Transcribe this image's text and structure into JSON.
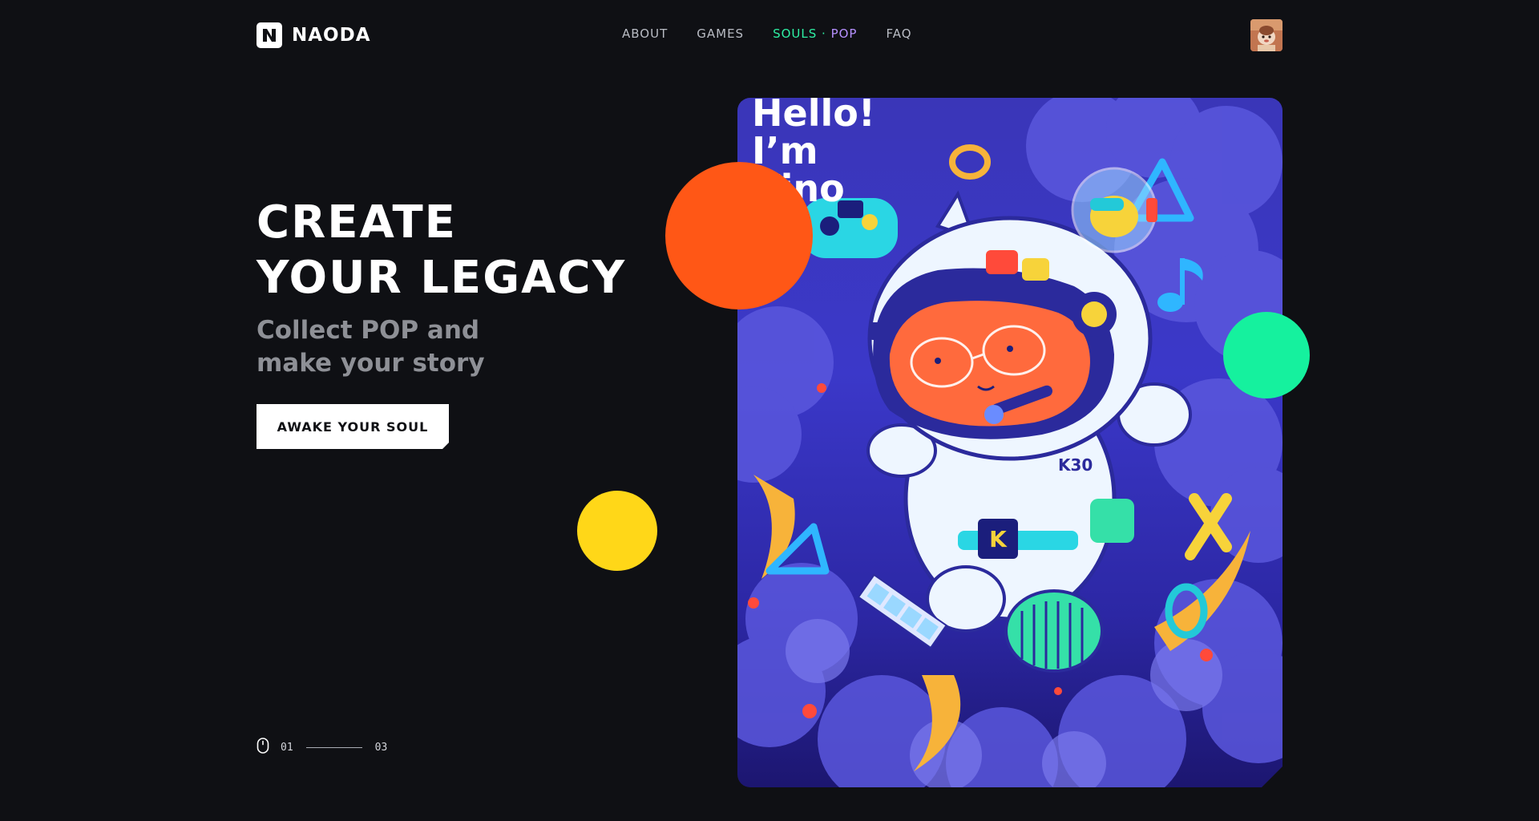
{
  "header": {
    "logo_text": "NAODA",
    "nav": {
      "about": "ABOUT",
      "games": "GAMES",
      "souls_pop_a": "SOULS",
      "souls_pop_sep": " · ",
      "souls_pop_b": "POP",
      "faq": "FAQ"
    }
  },
  "hero": {
    "title_line1": "CREATE",
    "title_line2": "YOUR LEGACY",
    "subtitle_line1": "Collect POP and",
    "subtitle_line2": "make your story",
    "cta_label": "AWAKE YOUR SOUL"
  },
  "indicator": {
    "current": "01",
    "total": "03",
    "progress_fraction": 0.33
  },
  "artwork": {
    "greeting_line1": "Hello!",
    "greeting_line2": "I’m",
    "greeting_line3": "Kino",
    "badge_text": "K30",
    "belt_letter": "K"
  },
  "colors": {
    "background": "#0f1014",
    "accent_orange": "#ff5716",
    "accent_green": "#15f19e",
    "accent_yellow": "#ffd718",
    "artwork_blue": "#3a36b8",
    "nav_gradient_start": "#2ef0a4",
    "nav_gradient_end": "#b690ff"
  },
  "icons": {
    "logo": "naoda-logo-icon",
    "scroll": "mouse-icon",
    "avatar": "user-avatar"
  }
}
